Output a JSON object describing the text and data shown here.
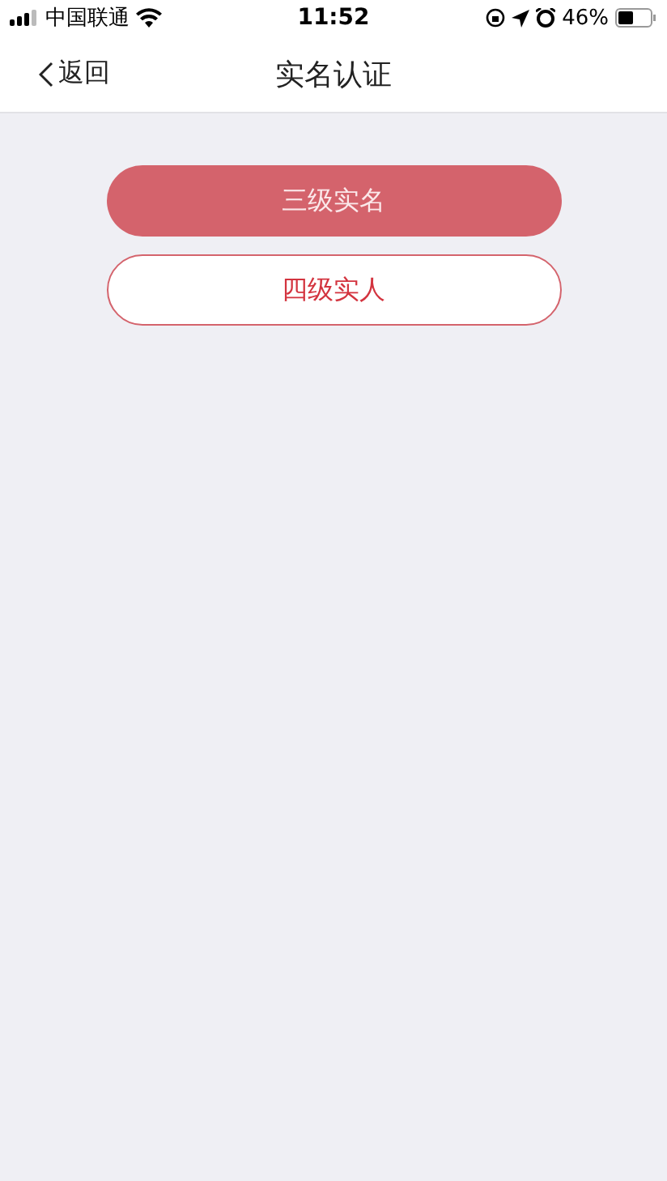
{
  "status_bar": {
    "carrier": "中国联通",
    "time": "11:52",
    "battery": "46%"
  },
  "nav_bar": {
    "back": "返回",
    "title": "实名认证"
  },
  "buttons": [
    {
      "label": "三级实名",
      "kind": "filled"
    },
    {
      "label": "四级实人",
      "kind": "outline"
    }
  ]
}
